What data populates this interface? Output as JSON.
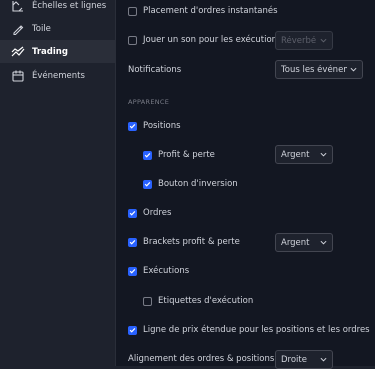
{
  "sidebar": {
    "items": [
      {
        "label": "Échelles et lignes",
        "icon": "scales-icon"
      },
      {
        "label": "Toile",
        "icon": "brush-icon"
      },
      {
        "label": "Trading",
        "icon": "trading-icon"
      },
      {
        "label": "Événements",
        "icon": "calendar-icon"
      }
    ]
  },
  "settings": {
    "instant_orders": "Placement d'ordres instantanés",
    "play_sound": "Jouer un son pour les exécutions",
    "sound_select": "Réverbé...",
    "notifications": "Notifications",
    "notifications_select": "Tous les événem...",
    "section_appearance": "APPARENCE",
    "positions": "Positions",
    "profit_loss": "Profit & perte",
    "profit_loss_select": "Argent",
    "reverse_button": "Bouton d'inversion",
    "orders": "Ordres",
    "brackets": "Brackets profit & perte",
    "brackets_select": "Argent",
    "executions": "Exécutions",
    "execution_labels": "Etiquettes d'exécution",
    "extended_price_line": "Ligne de prix étendue pour les positions et les ordres",
    "alignment": "Alignement des ordres & positions",
    "alignment_select": "Droite"
  },
  "colors": {
    "accent": "#2962ff",
    "background": "#131722",
    "sidebar": "#1e222d"
  }
}
